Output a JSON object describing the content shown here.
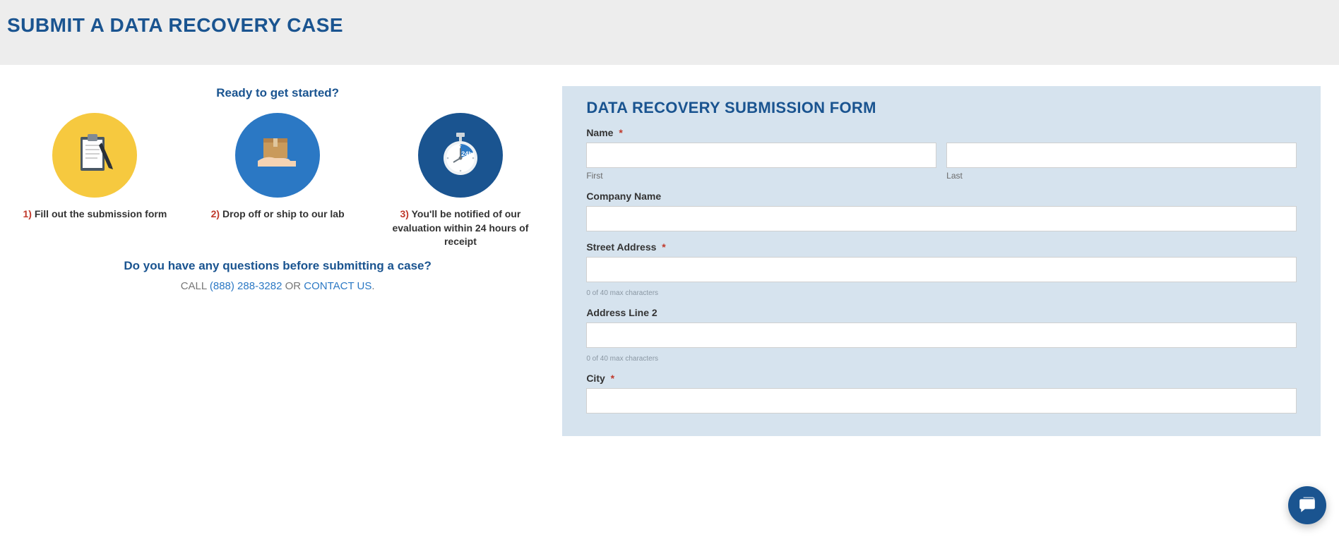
{
  "header": {
    "title": "SUBMIT A DATA RECOVERY CASE"
  },
  "left": {
    "ready": "Ready to get started?",
    "steps": [
      {
        "num": "1)",
        "text": "Fill out the submission form"
      },
      {
        "num": "2)",
        "text": "Drop off or ship to our lab"
      },
      {
        "num": "3)",
        "text": "You'll be notified of our evaluation within 24 hours of receipt"
      }
    ],
    "questions": "Do you have any questions before submitting a case?",
    "call_prefix": "CALL ",
    "phone": "(888) 288-3282",
    "call_sep": " OR ",
    "contact": "CONTACT US",
    "call_suffix": "."
  },
  "form": {
    "title": "DATA RECOVERY SUBMISSION FORM",
    "name_label": "Name",
    "first_sub": "First",
    "last_sub": "Last",
    "company_label": "Company Name",
    "street_label": "Street Address",
    "helper40": "0 of 40 max characters",
    "addr2_label": "Address Line 2",
    "city_label": "City",
    "values": {
      "first": "",
      "last": "",
      "company": "",
      "street": "",
      "addr2": "",
      "city": ""
    }
  },
  "req_mark": "*"
}
